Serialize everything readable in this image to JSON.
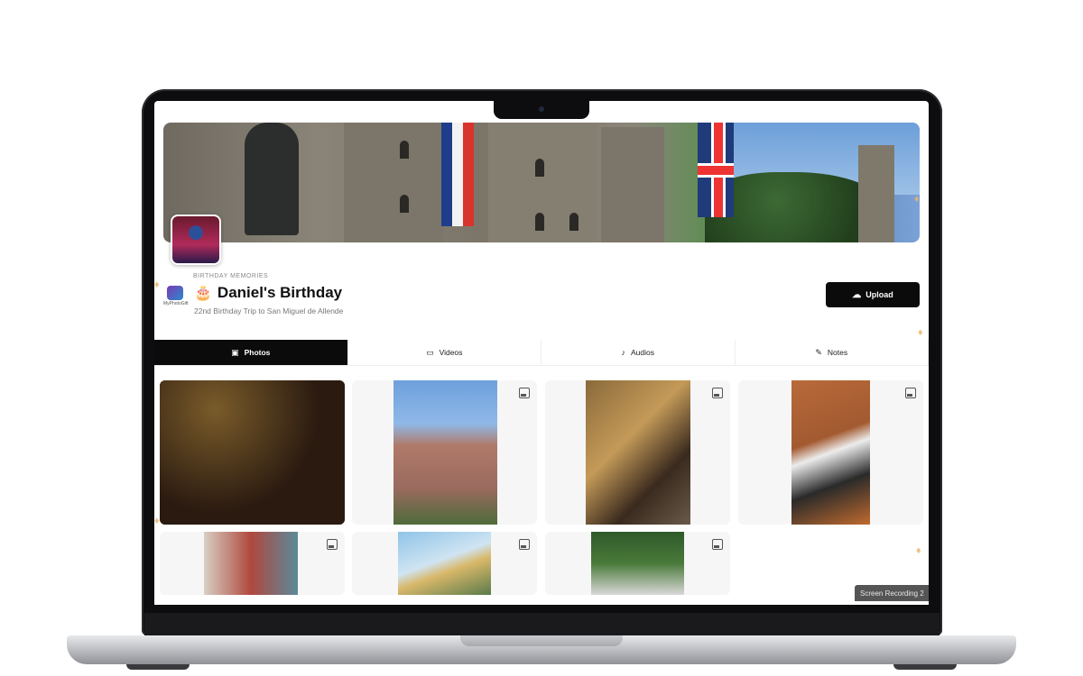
{
  "album": {
    "eyebrow": "BIRTHDAY MEMORIES",
    "title": "Daniel's Birthday",
    "title_emoji": "🎂",
    "subtitle": "22nd Birthday Trip to San Miguel de Allende"
  },
  "brand": {
    "logo_text": "MyPhotoGift"
  },
  "actions": {
    "upload_label": "Upload",
    "upload_icon": "cloud-upload-icon"
  },
  "tabs": [
    {
      "label": "Photos",
      "icon": "image-icon",
      "active": true
    },
    {
      "label": "Videos",
      "icon": "video-icon",
      "active": false
    },
    {
      "label": "Audios",
      "icon": "microphone-icon",
      "active": false
    },
    {
      "label": "Notes",
      "icon": "note-icon",
      "active": false
    }
  ],
  "overlay": {
    "recording_label": "Screen Recording 2"
  },
  "colors": {
    "accent": "#0b0b0b",
    "card_bg": "#f6f6f7"
  }
}
